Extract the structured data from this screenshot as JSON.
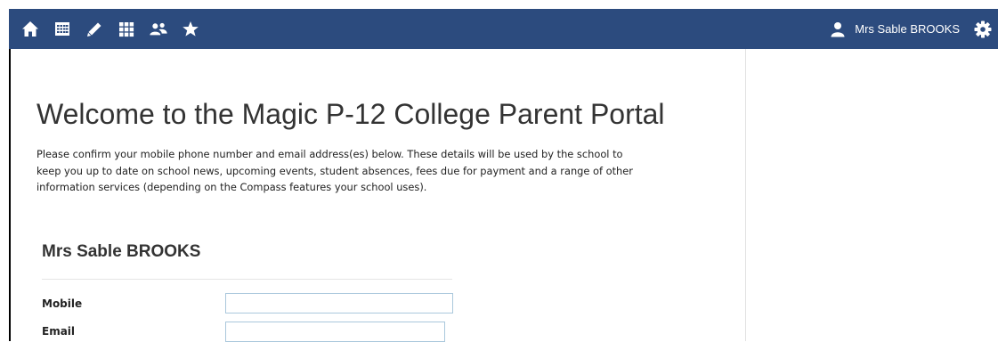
{
  "nav": {
    "icons": [
      {
        "name": "home-icon"
      },
      {
        "name": "calendar-icon"
      },
      {
        "name": "pencil-icon"
      },
      {
        "name": "grid-icon"
      },
      {
        "name": "people-icon"
      },
      {
        "name": "star-icon"
      }
    ],
    "user_name": "Mrs Sable BROOKS",
    "user_icon": "user-icon",
    "settings_icon": "gear-icon",
    "bar_color": "#2c4b7e"
  },
  "main": {
    "heading": "Welcome to the Magic P-12 College Parent Portal",
    "intro": "Please confirm your mobile phone number and email address(es) below. These details will be used by the school to keep you up to date on school news, upcoming events, student absences, fees due for payment and a range of other information services (depending on the Compass features your school uses).",
    "person_name": "Mrs Sable BROOKS",
    "form": {
      "mobile_label": "Mobile",
      "mobile_value": "",
      "email_label": "Email",
      "email_value": ""
    }
  }
}
